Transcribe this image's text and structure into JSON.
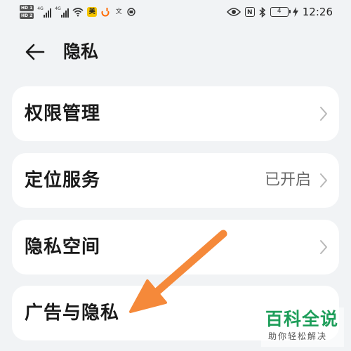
{
  "status_bar": {
    "hd1": "HD 1",
    "hd2": "HD 2",
    "network1": "4G",
    "network2": "4G",
    "app_badge_mei": "美",
    "app_badge_wen": "文",
    "nfc": "N",
    "battery": "4",
    "time": "12:26",
    "colors": {
      "mei_bg": "#f4c400",
      "didi": "#ff6a00"
    }
  },
  "header": {
    "back_icon": "arrow-left-icon",
    "title": "隐私"
  },
  "settings_items": [
    {
      "label": "权限管理",
      "value": ""
    },
    {
      "label": "定位服务",
      "value": "已开启"
    },
    {
      "label": "隐私空间",
      "value": ""
    },
    {
      "label": "广告与隐私",
      "value": ""
    }
  ],
  "watermark": {
    "main": "百科全说",
    "sub": "助你轻松解决"
  },
  "annotation": {
    "arrow_color": "#f5893a"
  }
}
